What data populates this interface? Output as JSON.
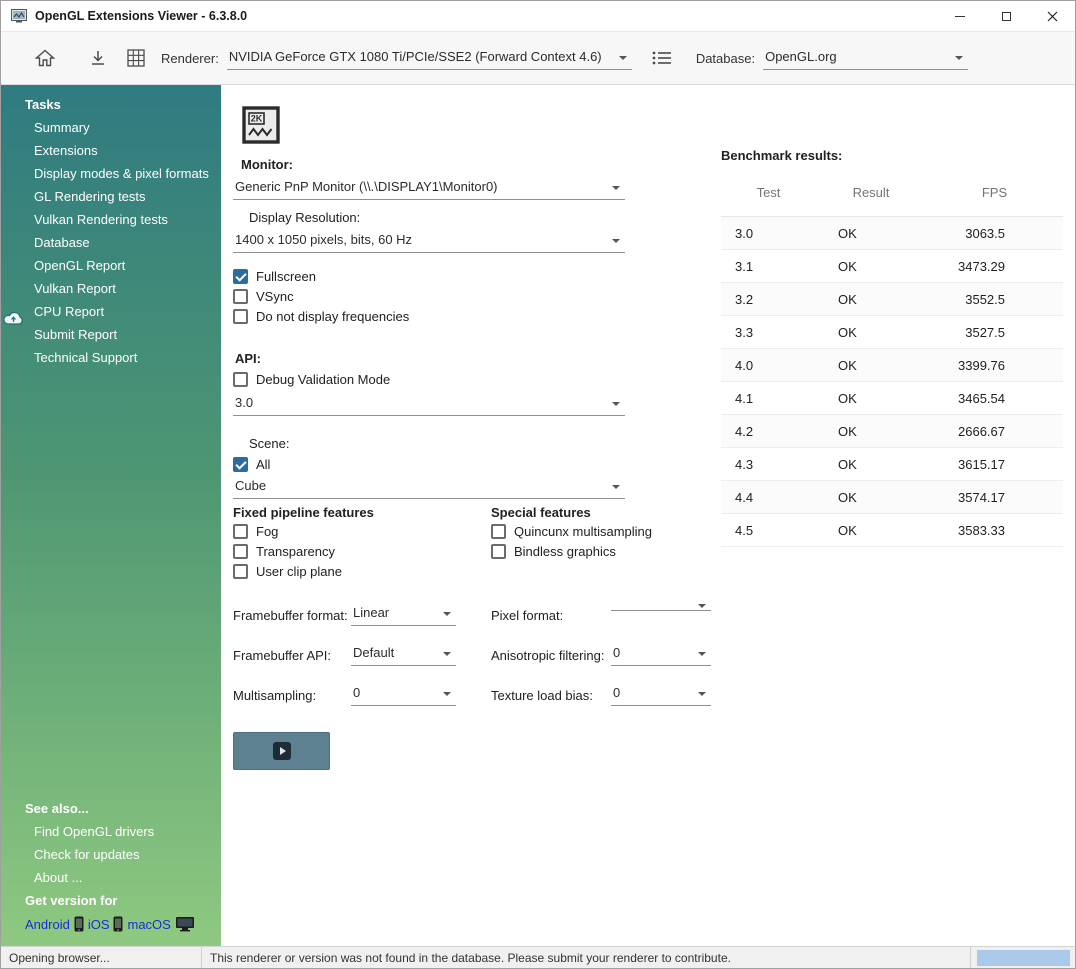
{
  "window": {
    "title": "OpenGL Extensions Viewer - 6.3.8.0"
  },
  "toolbar": {
    "renderer_label": "Renderer:",
    "renderer_value": "NVIDIA GeForce GTX 1080 Ti/PCIe/SSE2 (Forward Context 4.6)",
    "database_label": "Database:",
    "database_value": "OpenGL.org"
  },
  "sidebar": {
    "tasks_header": "Tasks",
    "tasks": [
      "Summary",
      "Extensions",
      "Display modes & pixel formats",
      "GL Rendering tests",
      "Vulkan Rendering tests",
      "Database",
      "OpenGL Report",
      "Vulkan Report",
      "CPU Report",
      "Submit Report",
      "Technical Support"
    ],
    "see_also_header": "See also...",
    "see_also": [
      "Find OpenGL drivers",
      "Check for updates",
      "About ..."
    ],
    "get_version_header": "Get version for",
    "version_links": {
      "android": "Android",
      "ios": "iOS",
      "macos": "macOS"
    }
  },
  "main": {
    "monitor_label": "Monitor:",
    "monitor_value": "Generic PnP Monitor (\\\\.\\DISPLAY1\\Monitor0)",
    "resolution_label": "Display Resolution:",
    "resolution_value": "1400 x 1050 pixels,  bits, 60 Hz",
    "api_label": "API:",
    "api_version": "3.0",
    "scene_label": "Scene:",
    "scene_value": "Cube",
    "fixed_features_header": "Fixed pipeline features",
    "special_features_header": "Special features",
    "checks": {
      "fullscreen": {
        "label": "Fullscreen",
        "checked": true
      },
      "vsync": {
        "label": "VSync",
        "checked": false
      },
      "no_frequencies": {
        "label": "Do not display frequencies",
        "checked": false
      },
      "debug_validation": {
        "label": "Debug Validation Mode",
        "checked": false
      },
      "scene_all": {
        "label": "All",
        "checked": true
      },
      "fog": {
        "label": "Fog",
        "checked": false
      },
      "transparency": {
        "label": "Transparency",
        "checked": false
      },
      "user_clip_plane": {
        "label": "User clip plane",
        "checked": false
      },
      "quincunx": {
        "label": "Quincunx multisampling",
        "checked": false
      },
      "bindless": {
        "label": "Bindless graphics",
        "checked": false
      }
    },
    "form": {
      "framebuffer_format": {
        "label": "Framebuffer format:",
        "value": "Linear"
      },
      "pixel_format": {
        "label": "Pixel format:",
        "value": ""
      },
      "framebuffer_api": {
        "label": "Framebuffer API:",
        "value": "Default"
      },
      "anisotropic_filtering": {
        "label": "Anisotropic filtering:",
        "value": "0"
      },
      "multisampling": {
        "label": "Multisampling:",
        "value": "0"
      },
      "texture_load_bias": {
        "label": "Texture load bias:",
        "value": "0"
      }
    }
  },
  "benchmark": {
    "title": "Benchmark results:",
    "columns": [
      "Test",
      "Result",
      "FPS"
    ],
    "rows": [
      [
        "3.0",
        "OK",
        "3063.5"
      ],
      [
        "3.1",
        "OK",
        "3473.29"
      ],
      [
        "3.2",
        "OK",
        "3552.5"
      ],
      [
        "3.3",
        "OK",
        "3527.5"
      ],
      [
        "4.0",
        "OK",
        "3399.76"
      ],
      [
        "4.1",
        "OK",
        "3465.54"
      ],
      [
        "4.2",
        "OK",
        "2666.67"
      ],
      [
        "4.3",
        "OK",
        "3615.17"
      ],
      [
        "4.4",
        "OK",
        "3574.17"
      ],
      [
        "4.5",
        "OK",
        "3583.33"
      ]
    ]
  },
  "statusbar": {
    "left": "Opening browser...",
    "message": "This renderer or version was not found in the database. Please submit your renderer to contribute."
  }
}
